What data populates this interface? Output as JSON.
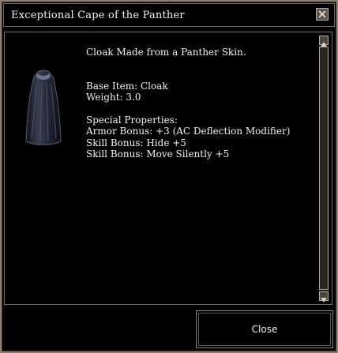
{
  "window": {
    "title": "Exceptional Cape of the Panther"
  },
  "item": {
    "description": "Cloak Made from a Panther Skin.",
    "base_item": "Base Item: Cloak",
    "weight": "Weight: 3.0",
    "special_header": "Special Properties:",
    "properties": [
      "Armor Bonus: +3 (AC Deflection Modifier)",
      "Skill Bonus: Hide +5",
      "Skill Bonus: Move Silently +5"
    ]
  },
  "buttons": {
    "close_label": "Close"
  },
  "colors": {
    "background": "#000000",
    "border": "#8a7f75",
    "text": "#f2f0ec"
  },
  "icons": {
    "close": "close-x-icon",
    "item": "cloak-icon",
    "up": "arrow-up-icon",
    "down": "arrow-down-icon"
  }
}
